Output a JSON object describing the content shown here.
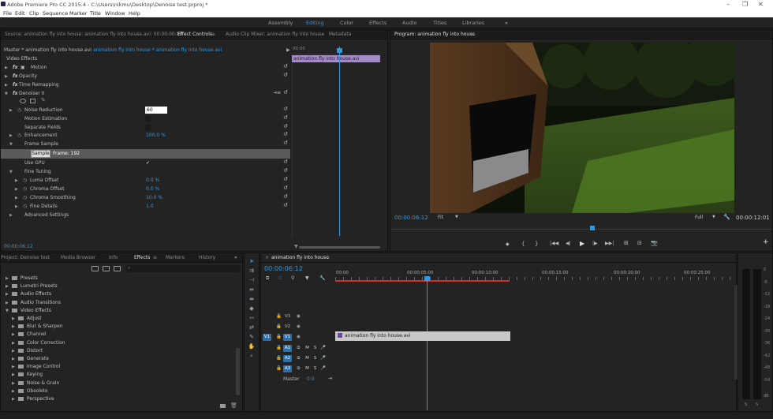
{
  "window": {
    "title": "Adobe Premiere Pro CC 2015.4 - C:\\Users\\nikmu\\Desktop\\Denoise test.prproj *",
    "controls": [
      "–",
      "❐",
      "✕"
    ]
  },
  "menu": [
    "File",
    "Edit",
    "Clip",
    "Sequence",
    "Marker",
    "Title",
    "Window",
    "Help"
  ],
  "workspaces": {
    "items": [
      "Assembly",
      "Editing",
      "Color",
      "Effects",
      "Audio",
      "Titles",
      "Libraries"
    ],
    "active": "Editing",
    "more": "»"
  },
  "source_tabs": {
    "source": "Source: animation fly into house: animation fly into house.avi: 00:00:00:00",
    "effect_controls": "Effect Controls",
    "audio_mixer": "Audio Clip Mixer: animation fly into house",
    "metadata": "Metadata",
    "menu_icon": "≡"
  },
  "effect_controls": {
    "master": "Master * animation fly into house.avi",
    "clip": "animation fly into house * animation fly into house.avi",
    "mini_timeline_start": "00:00",
    "mini_clip": "animation fly into house.avi",
    "section": "Video Effects",
    "effects": {
      "motion": "Motion",
      "opacity": "Opacity",
      "time_remapping": "Time Remapping",
      "denoiser": "Denoiser II"
    },
    "params": {
      "noise_reduction_label": "Noise Reduction",
      "noise_reduction_value": "60",
      "motion_estimation": "Motion Estimation",
      "separate_fields": "Separate Fields",
      "enhancement_label": "Enhancement",
      "enhancement_value": "100.0 %",
      "frame_sample": "Frame Sample",
      "sample_button": "Sample",
      "frame_label": "Frame: 192",
      "use_gpu": "Use GPU",
      "use_gpu_check": "✓",
      "fine_tuning": "Fine Tuning",
      "luma_offset_label": "Luma Offset",
      "luma_offset_value": "0.0 %",
      "chroma_offset_label": "Chroma Offset",
      "chroma_offset_value": "0.0 %",
      "chroma_smoothing_label": "Chroma Smoothing",
      "chroma_smoothing_value": "10.0 %",
      "fine_details_label": "Fine Details",
      "fine_details_value": "1.0",
      "advanced": "Advanced Settings"
    },
    "timecode": "00:00:06:12"
  },
  "program": {
    "title": "Program: animation fly into house",
    "menu_icon": "≡",
    "timecode": "00:00:06:12",
    "fit": "Fit",
    "quality": "Full",
    "duration": "00:00:12:01",
    "transport": [
      "◆",
      "{",
      "}",
      "|◀◀",
      "◀|",
      "▶",
      "|▶",
      "▶▶|",
      "⊞",
      "⊟",
      "📷"
    ],
    "add": "+"
  },
  "project": {
    "tabs": [
      "Project: Denoise test",
      "Media Browser",
      "Info",
      "Effects",
      "Markers",
      "History"
    ],
    "active": "Effects",
    "more": "»",
    "tree": [
      {
        "label": "Presets",
        "level": 0,
        "open": false
      },
      {
        "label": "Lumetri Presets",
        "level": 0,
        "open": false
      },
      {
        "label": "Audio Effects",
        "level": 0,
        "open": false
      },
      {
        "label": "Audio Transitions",
        "level": 0,
        "open": false
      },
      {
        "label": "Video Effects",
        "level": 0,
        "open": true
      },
      {
        "label": "Adjust",
        "level": 1,
        "open": false
      },
      {
        "label": "Blur & Sharpen",
        "level": 1,
        "open": false
      },
      {
        "label": "Channel",
        "level": 1,
        "open": false
      },
      {
        "label": "Color Correction",
        "level": 1,
        "open": false
      },
      {
        "label": "Distort",
        "level": 1,
        "open": false
      },
      {
        "label": "Generate",
        "level": 1,
        "open": false
      },
      {
        "label": "Image Control",
        "level": 1,
        "open": false
      },
      {
        "label": "Keying",
        "level": 1,
        "open": false
      },
      {
        "label": "Noise & Grain",
        "level": 1,
        "open": false
      },
      {
        "label": "Obsolete",
        "level": 1,
        "open": false
      },
      {
        "label": "Perspective",
        "level": 1,
        "open": false
      }
    ]
  },
  "timeline": {
    "tab": "animation fly into house",
    "close": "×",
    "menu_icon": "≡",
    "timecode": "00:00:06:12",
    "ruler": [
      "00:00",
      "00:00:05:00",
      "00:00:10:00",
      "00:00:15:00",
      "00:00:20:00",
      "00:00:25:00"
    ],
    "tracks": [
      {
        "name": "V3",
        "src": ""
      },
      {
        "name": "V2",
        "src": ""
      },
      {
        "name": "V1",
        "src": "V1"
      },
      {
        "name": "A1",
        "src": ""
      },
      {
        "name": "A2",
        "src": ""
      },
      {
        "name": "A3",
        "src": ""
      }
    ],
    "master_label": "Master",
    "master_value": "0.0",
    "clip": "animation fly into house.avi",
    "track_toggles": {
      "m": "M",
      "s": "S"
    }
  },
  "meters": {
    "scale": [
      "0",
      "-6",
      "-12",
      "-18",
      "-24",
      "-30",
      "-36",
      "-42",
      "-48",
      "-54"
    ],
    "db": "dB",
    "solo": [
      "S",
      "S"
    ]
  },
  "colors": {
    "accent": "#2d9ae6",
    "clip": "#c8c8c8",
    "playhead": "#2d9ae6",
    "render_bar": "#d62a2a"
  }
}
